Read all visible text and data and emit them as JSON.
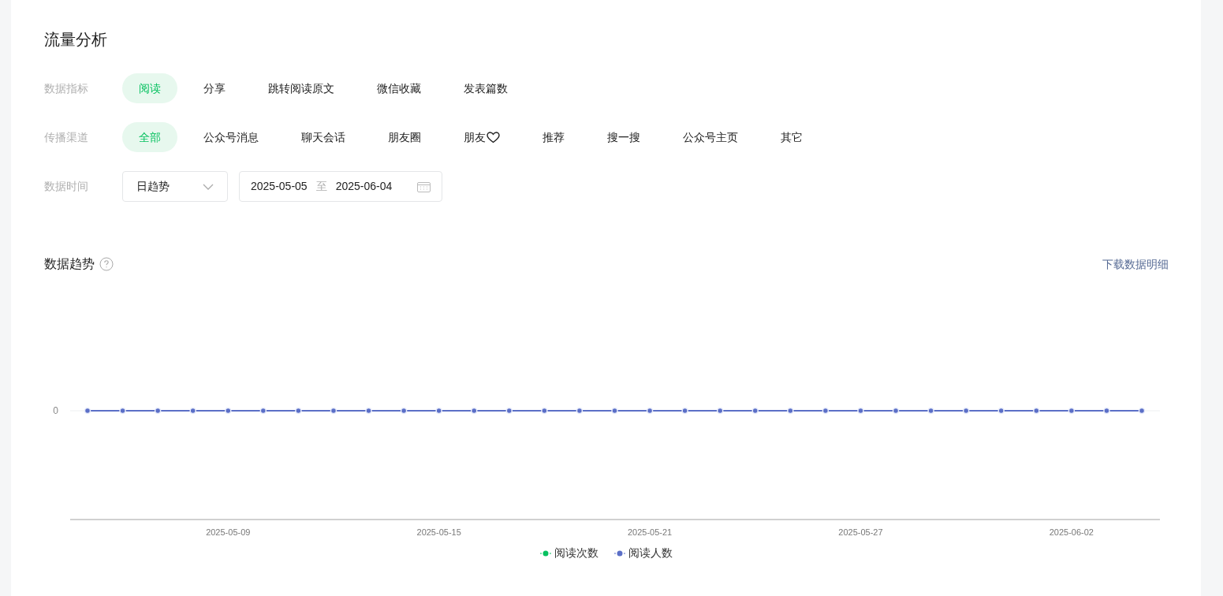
{
  "title": "流量分析",
  "filters": [
    {
      "label": "数据指标",
      "options": [
        {
          "text": "阅读",
          "selected": true
        },
        {
          "text": "分享",
          "selected": false
        },
        {
          "text": "跳转阅读原文",
          "selected": false
        },
        {
          "text": "微信收藏",
          "selected": false
        },
        {
          "text": "发表篇数",
          "selected": false
        }
      ]
    },
    {
      "label": "传播渠道",
      "options": [
        {
          "text": "全部",
          "selected": true
        },
        {
          "text": "公众号消息",
          "selected": false
        },
        {
          "text": "聊天会话",
          "selected": false
        },
        {
          "text": "朋友圈",
          "selected": false
        },
        {
          "text": "朋友",
          "selected": false,
          "kind": "heart"
        },
        {
          "text": "推荐",
          "selected": false
        },
        {
          "text": "搜一搜",
          "selected": false
        },
        {
          "text": "公众号主页",
          "selected": false
        },
        {
          "text": "其它",
          "selected": false
        }
      ]
    }
  ],
  "time": {
    "label": "数据时间",
    "mode": "日趋势",
    "start": "2025-05-05",
    "separator": "至",
    "end": "2025-06-04"
  },
  "trend": {
    "title": "数据趋势",
    "download": "下载数据明细",
    "chart": {
      "y_label": "0",
      "x_labels": [
        "2025-05-09",
        "2025-05-15",
        "2025-05-21",
        "2025-05-27",
        "2025-06-02"
      ],
      "legend": [
        {
          "name": "阅读次数",
          "color": "#07c160"
        },
        {
          "name": "阅读人数",
          "color": "#5b6fc7"
        }
      ]
    }
  }
}
